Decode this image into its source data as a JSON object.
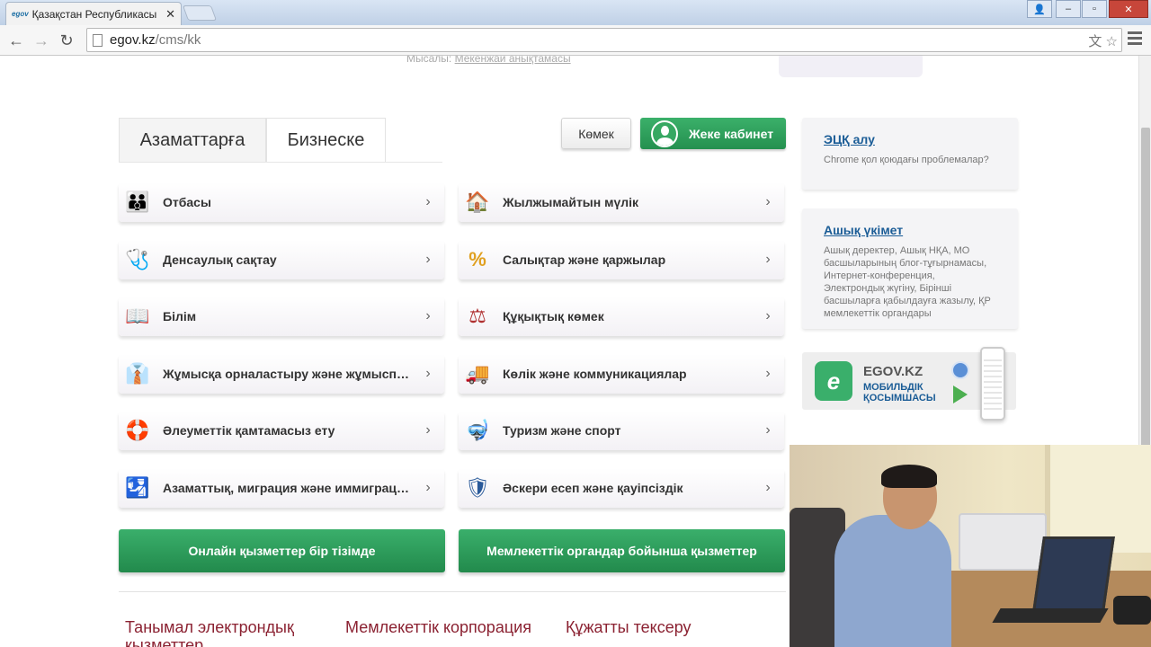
{
  "browser": {
    "tab_title": "Қазақстан Республикасы",
    "favicon_text": "egov",
    "close_symbol": "✕",
    "url_domain": "egov.kz",
    "url_path": "/cms/kk",
    "back_symbol": "←",
    "forward_symbol": "→",
    "reload_symbol": "↻",
    "translate_symbol": "文",
    "star_symbol": "☆",
    "win_min": "–",
    "win_max": "▫",
    "win_close": "✕",
    "win_user": "👤"
  },
  "header_hint": {
    "prefix": "Мысалы:",
    "link": "Мекенжай анықтамасы"
  },
  "tabs": [
    {
      "label": "Азаматтарға",
      "active": true
    },
    {
      "label": "Бизнеске",
      "active": false
    }
  ],
  "actions": {
    "help": "Көмек",
    "cabinet": "Жеке кабинет"
  },
  "categories_left": [
    {
      "label": "Отбасы",
      "icon": "family-icon",
      "glyph": "👪"
    },
    {
      "label": "Денсаулық сақтау",
      "icon": "first-aid-icon",
      "glyph": "🩺"
    },
    {
      "label": "Білім",
      "icon": "book-icon",
      "glyph": "📖"
    },
    {
      "label": "Жұмысқа орналастыру және жұмыспен қамту",
      "icon": "worker-icon",
      "glyph": "👔"
    },
    {
      "label": "Әлеуметтік қамтамасыз ету",
      "icon": "lifebuoy-icon",
      "glyph": "🛟"
    },
    {
      "label": "Азаматтық, миграция және иммиграция",
      "icon": "passport-icon",
      "glyph": "🛂"
    }
  ],
  "categories_right": [
    {
      "label": "Жылжымайтын мүлік",
      "icon": "house-icon",
      "glyph": "🏠"
    },
    {
      "label": "Салықтар және қаржылар",
      "icon": "percent-icon",
      "glyph": "%"
    },
    {
      "label": "Құқықтық көмек",
      "icon": "scales-icon",
      "glyph": "⚖"
    },
    {
      "label": "Көлік және коммуникациялар",
      "icon": "truck-icon",
      "glyph": "🚚"
    },
    {
      "label": "Туризм және спорт",
      "icon": "snorkel-mask-icon",
      "glyph": "🤿"
    },
    {
      "label": "Әскери есеп және қауіпсіздік",
      "icon": "shield-icon",
      "glyph": "🛡"
    }
  ],
  "chevron": "›",
  "buttons": {
    "online_services": "Онлайн қызметтер бір тізімде",
    "gov_services": "Мемлекеттік органдар бойынша қызметтер"
  },
  "bottom_links": [
    "Танымал электрондық қызметтер",
    "Мемлекеттік корпорация",
    "Құжатты тексеру"
  ],
  "sidebar": {
    "ecp": {
      "title": "ЭЦҚ алу",
      "text": "Chrome қол қоюдағы проблемалар?"
    },
    "open_gov": {
      "title": "Ашық үкімет",
      "text": "Ашық деректер, Ашық НҚА, МО басшыларының блог-тұғырнамасы, Интернет-конференция, Электрондық жүгіну, Бірінші басшыларға қабылдауға жазылу, ҚР мемлекеттік органдары"
    },
    "app": {
      "logo": "e",
      "name": "EGOV.KZ",
      "subtitle": "МОБИЛЬДІК ҚОСЫМШАСЫ"
    }
  }
}
